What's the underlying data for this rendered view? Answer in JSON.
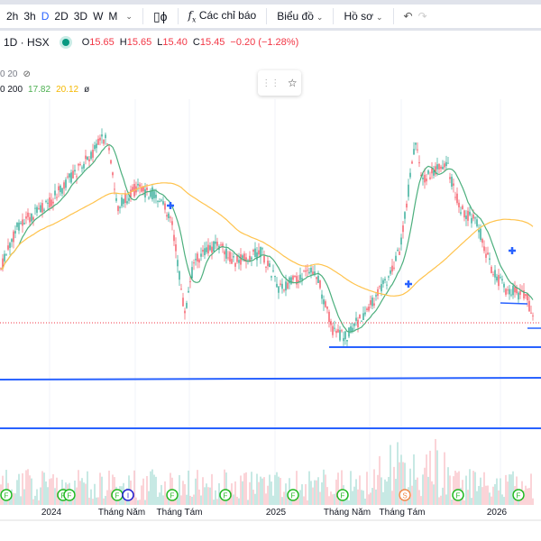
{
  "toolbar": {
    "intervals": [
      "2h",
      "3h",
      "D",
      "2D",
      "3D",
      "W",
      "M"
    ],
    "active_interval": "D",
    "indicators_label": "Các chỉ báo",
    "chart_label": "Biểu đồ",
    "profile_label": "Hồ sơ"
  },
  "legend": {
    "symbol": "1D · HSX",
    "open_label": "O",
    "open": "15.65",
    "high_label": "H",
    "high": "15.65",
    "low_label": "L",
    "low": "15.40",
    "close_label": "C",
    "close": "15.45",
    "change": "−0.20 (−1.28%)"
  },
  "indicators": [
    {
      "label": "0 20"
    },
    {
      "label": "0 200",
      "v1": "17.82",
      "v2": "20.12",
      "icon": "ø"
    }
  ],
  "xaxis": [
    "2024",
    "Tháng Năm",
    "Tháng Tám",
    "2025",
    "Tháng Năm",
    "Tháng Tám",
    "2026"
  ],
  "events": [
    "F",
    "F",
    "F",
    "I",
    "F",
    "F",
    "F",
    "F",
    "S",
    "F",
    "F"
  ],
  "colors": {
    "up": "#089981",
    "down": "#f23645",
    "ma_short": "#4caf7d",
    "ma_long": "#ffc34d",
    "lines": "#2962ff"
  }
}
